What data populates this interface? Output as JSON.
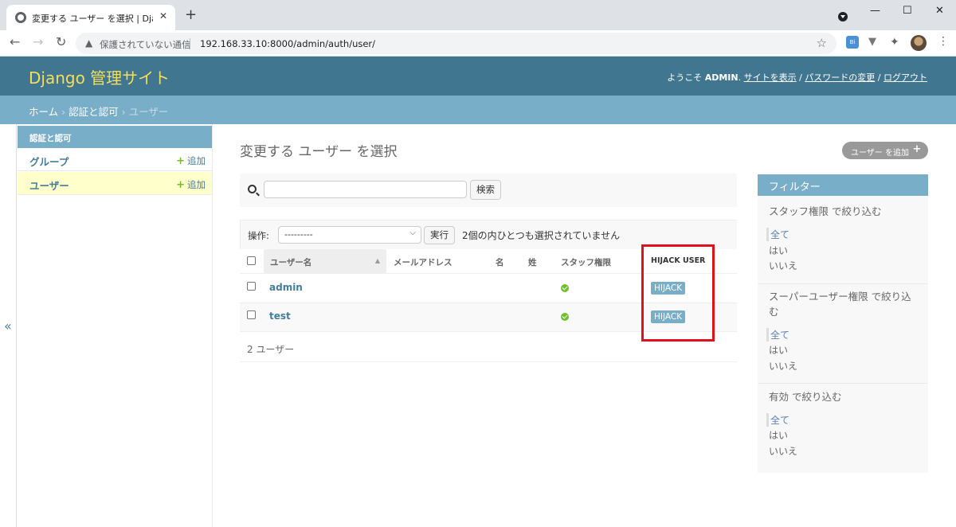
{
  "browser": {
    "tab_title": "変更する ユーザー を選択 | Django サイト管理",
    "new_tab": "+",
    "not_secure_label": "保護されていない通信",
    "url": "192.168.33.10:8000/admin/auth/user/"
  },
  "header": {
    "branding": "Django 管理サイト",
    "welcome": "ようこそ",
    "username": "ADMIN",
    "view_site": "サイトを表示",
    "change_password": "パスワードの変更",
    "logout": "ログアウト"
  },
  "breadcrumbs": {
    "home": "ホーム",
    "app": "認証と認可",
    "current": "ユーザー",
    "sep": "›"
  },
  "nav": {
    "app_caption": "認証と認可",
    "items": [
      {
        "label": "グループ",
        "add": "追加"
      },
      {
        "label": "ユーザー",
        "add": "追加"
      }
    ],
    "collapse": "«"
  },
  "content": {
    "title": "変更する ユーザー を選択",
    "add_button": "ユーザー を追加",
    "search_button": "検索",
    "search_value": "",
    "actions_label": "操作:",
    "action_selected": "---------",
    "go_button": "実行",
    "action_counter": "2個の内ひとつも選択されていません",
    "columns": [
      "ユーザー名",
      "メールアドレス",
      "名",
      "姓",
      "スタッフ権限",
      "HIJACK USER"
    ],
    "rows": [
      {
        "username": "admin",
        "email": "",
        "first": "",
        "last": "",
        "staff": true,
        "hijack": "HIJACK"
      },
      {
        "username": "test",
        "email": "",
        "first": "",
        "last": "",
        "staff": true,
        "hijack": "HIJACK"
      }
    ],
    "paginator": "2 ユーザー"
  },
  "filter": {
    "title": "フィルター",
    "groups": [
      {
        "title": "スタッフ権限 で絞り込む",
        "options": [
          "全て",
          "はい",
          "いいえ"
        ],
        "selected": "全て"
      },
      {
        "title": "スーパーユーザー権限 で絞り込む",
        "options": [
          "全て",
          "はい",
          "いいえ"
        ],
        "selected": "全て"
      },
      {
        "title": "有効 で絞り込む",
        "options": [
          "全て",
          "はい",
          "いいえ"
        ],
        "selected": "全て"
      }
    ]
  },
  "colors": {
    "header_bg": "#417690",
    "branding": "#f5dd5d",
    "accent": "#79aec8",
    "link": "#447e9b",
    "add_green": "#70bf2b",
    "highlight_red": "#e0111a"
  }
}
